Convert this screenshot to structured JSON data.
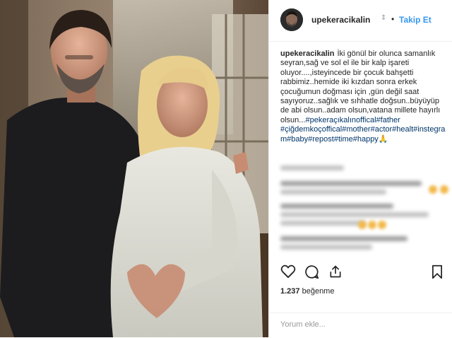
{
  "post": {
    "username": "upekeracikalin",
    "follow_label": "Takip Et",
    "separator": "•",
    "caption_text": "İki gönül bir olunca samanlık seyran,sağ ve sol el ile bir kalp işareti oluyor....,isteyincede bir çocuk bahşetti rabbimiz..hemide iki kızdan sonra erkek çocuğumun doğması için ,gün değil saat sayıyoruz..sağlık ve sıhhatle doğsun..büyüyüp de abi olsun..adam olsun,vatana millete hayırlı olsun...",
    "caption_tags": "#pekeraçıkalınoffical#father #çiğdemkoçoffical#mother#actor#healt#instegram#baby#repost#time#happy",
    "caption_emoji": "🙏",
    "likes_count": "1.237",
    "likes_label": "beğenme",
    "comment_placeholder": "Yorum ekle..."
  },
  "icons": {
    "heart": "heart-icon",
    "comment": "comment-icon",
    "share": "share-icon",
    "save": "bookmark-icon"
  },
  "colors": {
    "link_blue": "#3897f0",
    "hashtag": "#003569",
    "text": "#262626",
    "muted": "#999999"
  }
}
